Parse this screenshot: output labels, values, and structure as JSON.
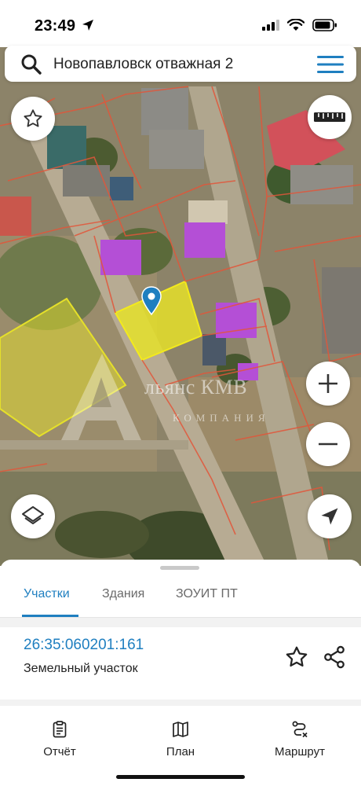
{
  "status_bar": {
    "time": "23:49"
  },
  "search": {
    "query": "Новопавловск отважная 2"
  },
  "watermark": {
    "line1": "льянс КМВ",
    "line2": "КОМПАНИЯ",
    "letter": "А"
  },
  "map_controls": {
    "favorite_icon": "star-outline-icon",
    "ruler_icon": "ruler-icon",
    "zoom_in_icon": "plus-icon",
    "zoom_out_icon": "minus-icon",
    "layers_icon": "layers-icon",
    "locate_icon": "navigation-arrow-icon"
  },
  "sheet": {
    "tabs": [
      {
        "label": "Участки",
        "active": true
      },
      {
        "label": "Здания",
        "active": false
      },
      {
        "label": "ЗОУИТ ПТ",
        "active": false
      }
    ],
    "parcel": {
      "cadastral_number": "26:35:060201:161",
      "type": "Земельный участок"
    }
  },
  "bottom_nav": [
    {
      "label": "Отчёт",
      "icon": "clipboard-icon"
    },
    {
      "label": "План",
      "icon": "map-icon"
    },
    {
      "label": "Маршрут",
      "icon": "route-icon"
    }
  ],
  "colors": {
    "accent": "#1f7fc0",
    "selected_parcel": "#e5e02a",
    "building_highlight": "#b44fd6",
    "parcel_boundary": "#e2563a"
  }
}
